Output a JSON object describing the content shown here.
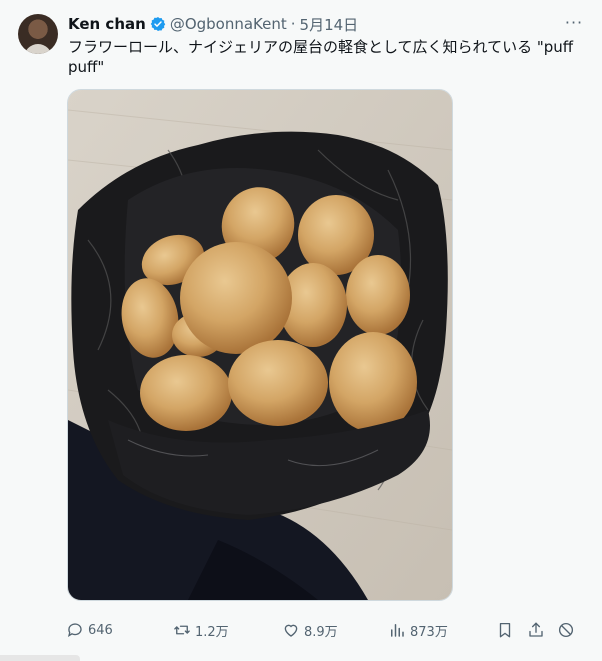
{
  "tweet": {
    "author_name": "Ken chan",
    "handle": "@OgbonnaKent",
    "separator": "·",
    "date": "5月14日",
    "text": "フラワーロール、ナイジェリアの屋台の軽食として広く知られている \"puff puff\"",
    "more_label": "···"
  },
  "actions": {
    "replies": "646",
    "retweets": "1.2万",
    "likes": "8.9万",
    "views": "873万"
  },
  "icons": {
    "verified": "verified-badge-icon",
    "reply": "reply-icon",
    "retweet": "retweet-icon",
    "like": "heart-icon",
    "views": "views-chart-icon",
    "bookmark": "bookmark-icon",
    "share": "share-icon",
    "block": "not-interested-icon"
  },
  "colors": {
    "accent": "#1d9bf0",
    "text": "#0f1419",
    "secondary": "#536471"
  }
}
